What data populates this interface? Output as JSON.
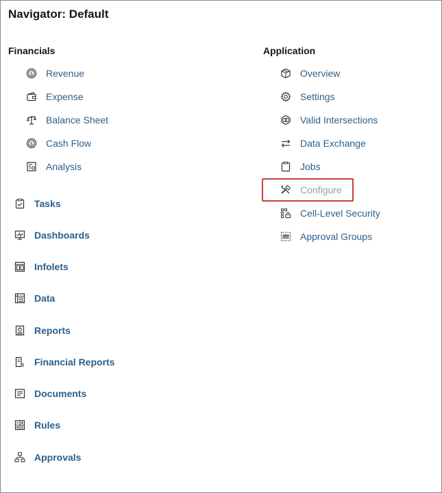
{
  "page": {
    "title": "Navigator: Default"
  },
  "financials": {
    "heading": "Financials",
    "items": [
      {
        "label": "Revenue",
        "icon": "dollar-circle-icon"
      },
      {
        "label": "Expense",
        "icon": "wallet-icon"
      },
      {
        "label": "Balance Sheet",
        "icon": "scale-icon"
      },
      {
        "label": "Cash Flow",
        "icon": "dollar-circle-icon"
      },
      {
        "label": "Analysis",
        "icon": "analysis-icon"
      }
    ]
  },
  "main_nav": [
    {
      "label": "Tasks",
      "icon": "clipboard-check-icon"
    },
    {
      "label": "Dashboards",
      "icon": "monitor-chart-icon"
    },
    {
      "label": "Infolets",
      "icon": "infolet-icon"
    },
    {
      "label": "Data",
      "icon": "data-grid-icon"
    },
    {
      "label": "Reports",
      "icon": "report-icon"
    },
    {
      "label": "Financial Reports",
      "icon": "financial-report-icon"
    },
    {
      "label": "Documents",
      "icon": "document-icon"
    },
    {
      "label": "Rules",
      "icon": "rules-icon"
    },
    {
      "label": "Approvals",
      "icon": "hierarchy-icon"
    }
  ],
  "application": {
    "heading": "Application",
    "items": [
      {
        "label": "Overview",
        "icon": "cube-icon"
      },
      {
        "label": "Settings",
        "icon": "gear-icon"
      },
      {
        "label": "Valid Intersections",
        "icon": "intersection-icon"
      },
      {
        "label": "Data Exchange",
        "icon": "exchange-arrows-icon"
      },
      {
        "label": "Jobs",
        "icon": "clipboard-icon"
      },
      {
        "label": "Configure",
        "icon": "tools-icon",
        "disabled": true
      },
      {
        "label": "Cell-Level Security",
        "icon": "cell-security-icon"
      },
      {
        "label": "Approval Groups",
        "icon": "approval-groups-icon"
      }
    ]
  },
  "colors": {
    "link": "#2b5f8a",
    "disabled": "#9b9b9b",
    "highlight": "#c9403a"
  }
}
